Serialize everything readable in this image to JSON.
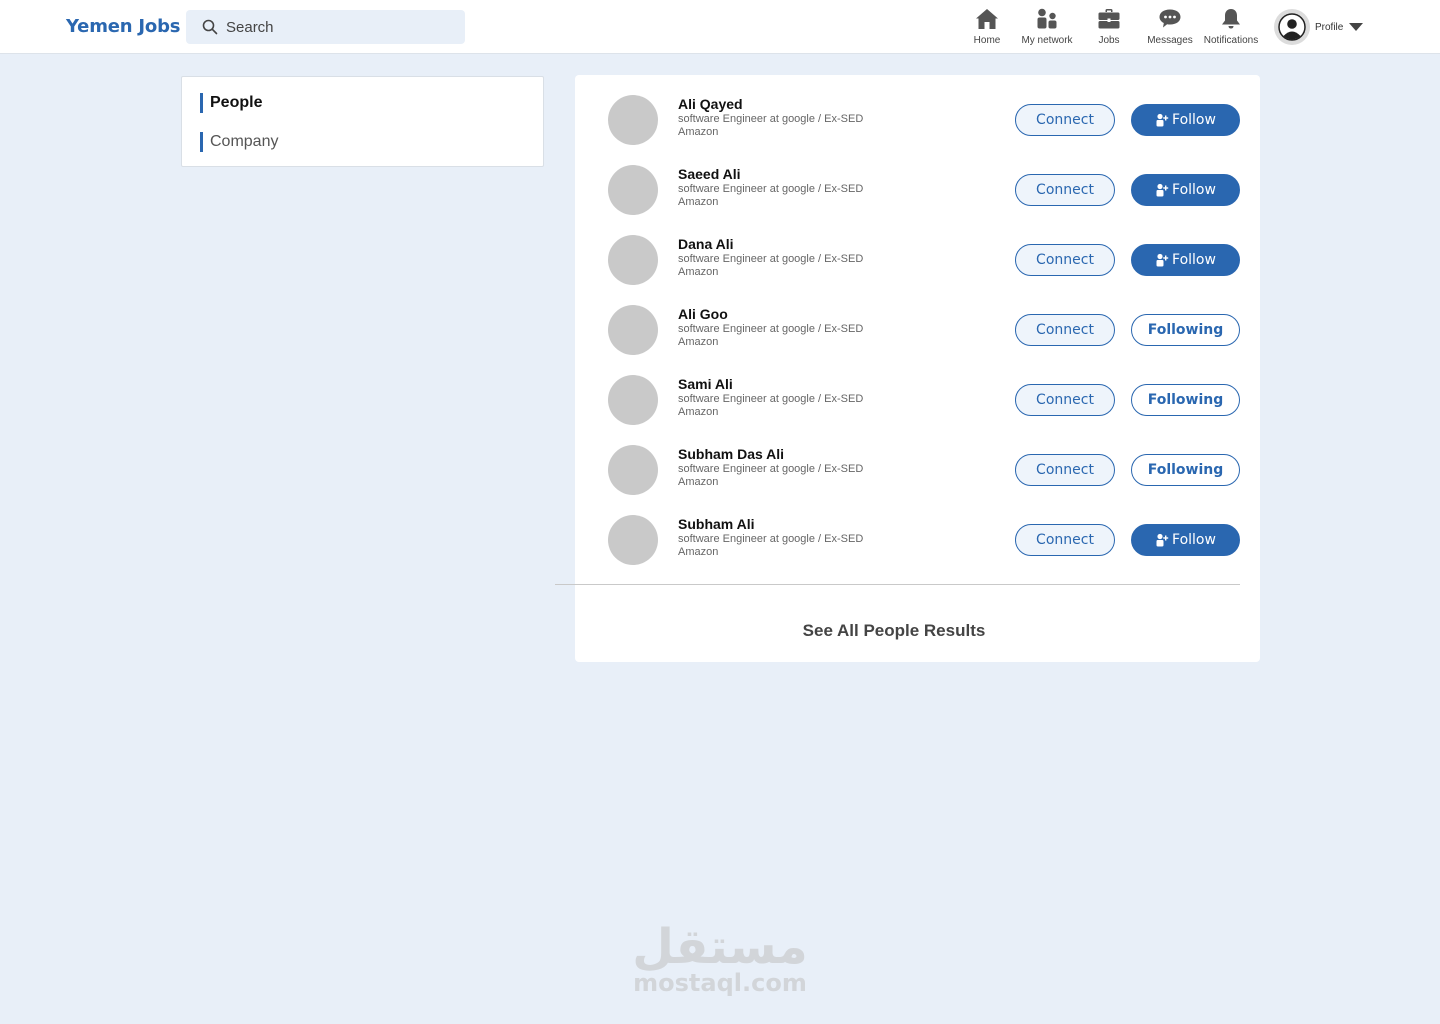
{
  "header": {
    "brand": "Yemen Jobs",
    "search_placeholder": "Search",
    "nav": {
      "home": "Home",
      "network": "My network",
      "jobs": "Jobs",
      "messages": "Messages",
      "notifications": "Notifications"
    },
    "profile_label": "Profile"
  },
  "filters": {
    "people": "People",
    "company": "Company"
  },
  "results": {
    "connect_label": "Connect",
    "follow_label": "Follow",
    "following_label": "Following",
    "people": [
      {
        "name": "Ali Qayed",
        "headline": "software Engineer at google / Ex-SED Amazon",
        "following": false
      },
      {
        "name": "Saeed Ali",
        "headline": "software Engineer at google / Ex-SED Amazon",
        "following": false
      },
      {
        "name": "Dana Ali",
        "headline": "software Engineer at google / Ex-SED Amazon",
        "following": false
      },
      {
        "name": "Ali Goo",
        "headline": "software Engineer at google / Ex-SED Amazon",
        "following": true
      },
      {
        "name": "Sami Ali",
        "headline": "software Engineer at google / Ex-SED Amazon",
        "following": true
      },
      {
        "name": "Subham Das Ali",
        "headline": "software Engineer at google / Ex-SED Amazon",
        "following": true
      },
      {
        "name": "Subham Ali",
        "headline": "software Engineer at google / Ex-SED Amazon",
        "following": false
      }
    ],
    "see_all": "See All People Results"
  },
  "watermark": {
    "arabic": "مستقل",
    "latin": "mostaql.com"
  },
  "colors": {
    "brand": "#2a67b0",
    "background": "#e8eff8",
    "avatar_placeholder": "#c9c9c9"
  }
}
